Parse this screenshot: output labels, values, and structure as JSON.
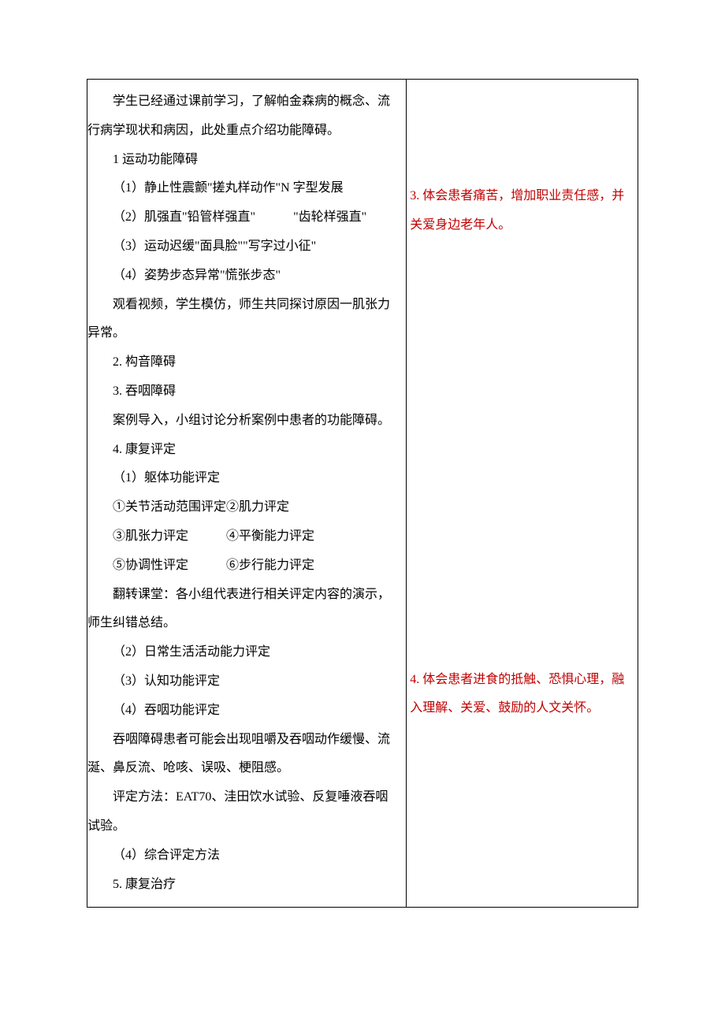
{
  "left": {
    "intro": "学生已经通过课前学习，了解帕金森病的概念、流行病学现状和病因，此处重点介绍功能障碍。",
    "s1_title": "1 运动功能障碍",
    "s1_1": "（1）静止性震颤\"搓丸样动作\"N 字型发展",
    "s1_2a": "（2）肌强直\"铅管样强直\"",
    "s1_2b": "\"齿轮样强直\"",
    "s1_3": "（3）运动迟缓\"面具脸\"\"写字过小征\"",
    "s1_4": "（4）姿势步态异常\"慌张步态\"",
    "s1_note": "观看视频，学生模仿，师生共同探讨原因一肌张力异常。",
    "s2": "2. 构音障碍",
    "s3": "3. 吞咽障碍",
    "case_intro": "案例导入，小组讨论分析案例中患者的功能障碍。",
    "s4": "4. 康复评定",
    "s4_1": "（1）躯体功能评定",
    "s4_1_a": "①关节活动范围评定②肌力评定",
    "s4_1_c": "③肌张力评定",
    "s4_1_d": "④平衡能力评定",
    "s4_1_e": "⑤协调性评定",
    "s4_1_f": "⑥步行能力评定",
    "flip": "翻转课堂：各小组代表进行相关评定内容的演示，师生纠错总结。",
    "s4_2": "（2）日常生活活动能力评定",
    "s4_3": "（3）认知功能评定",
    "s4_4": "（4）吞咽功能评定",
    "swallow_note": "吞咽障碍患者可能会出现咀嚼及吞咽动作缓慢、流涎、鼻反流、呛咳、误吸、梗阻感。",
    "eval_method": "评定方法：EAT70、洼田饮水试验、反复唾液吞咽试验。",
    "s4_5": "（4）综合评定方法",
    "s5": "5. 康复治疗"
  },
  "right": {
    "note3": "3. 体会患者痛苦，增加职业责任感，并关爱身边老年人。",
    "note4": "4. 体会患者进食的抵触、恐惧心理，融入理解、关爱、鼓励的人文关怀。"
  }
}
